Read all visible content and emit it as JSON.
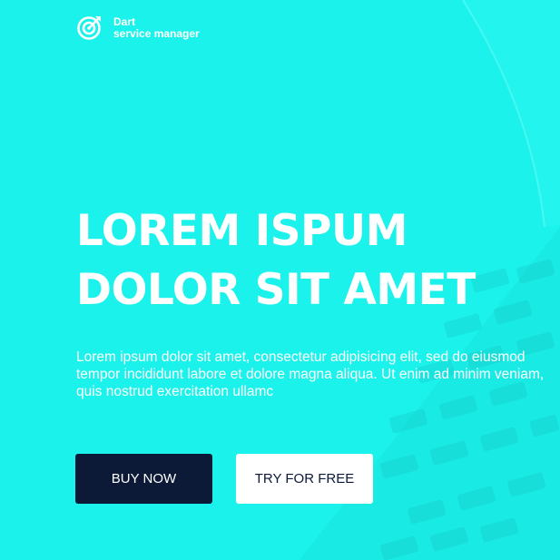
{
  "brand": {
    "name": "Dart",
    "tagline": "service manager",
    "icon": "target-arrow-icon"
  },
  "hero": {
    "headline_line1": "LOREM ISPUM",
    "headline_line2": "DOLOR SIT AMET",
    "lead": "Lorem ipsum dolor sit amet, consectetur adipisicing elit, sed do eiusmod tempor incididunt labore et dolore magna aliqua. Ut enim ad minim veniam, quis nostrud exercitation ullamc",
    "primary_button": "BUY NOW",
    "secondary_button": "TRY FOR FREE"
  },
  "colors": {
    "background": "#1cf2ec",
    "primary_button": "#0c1a38",
    "text": "#ffffff"
  }
}
